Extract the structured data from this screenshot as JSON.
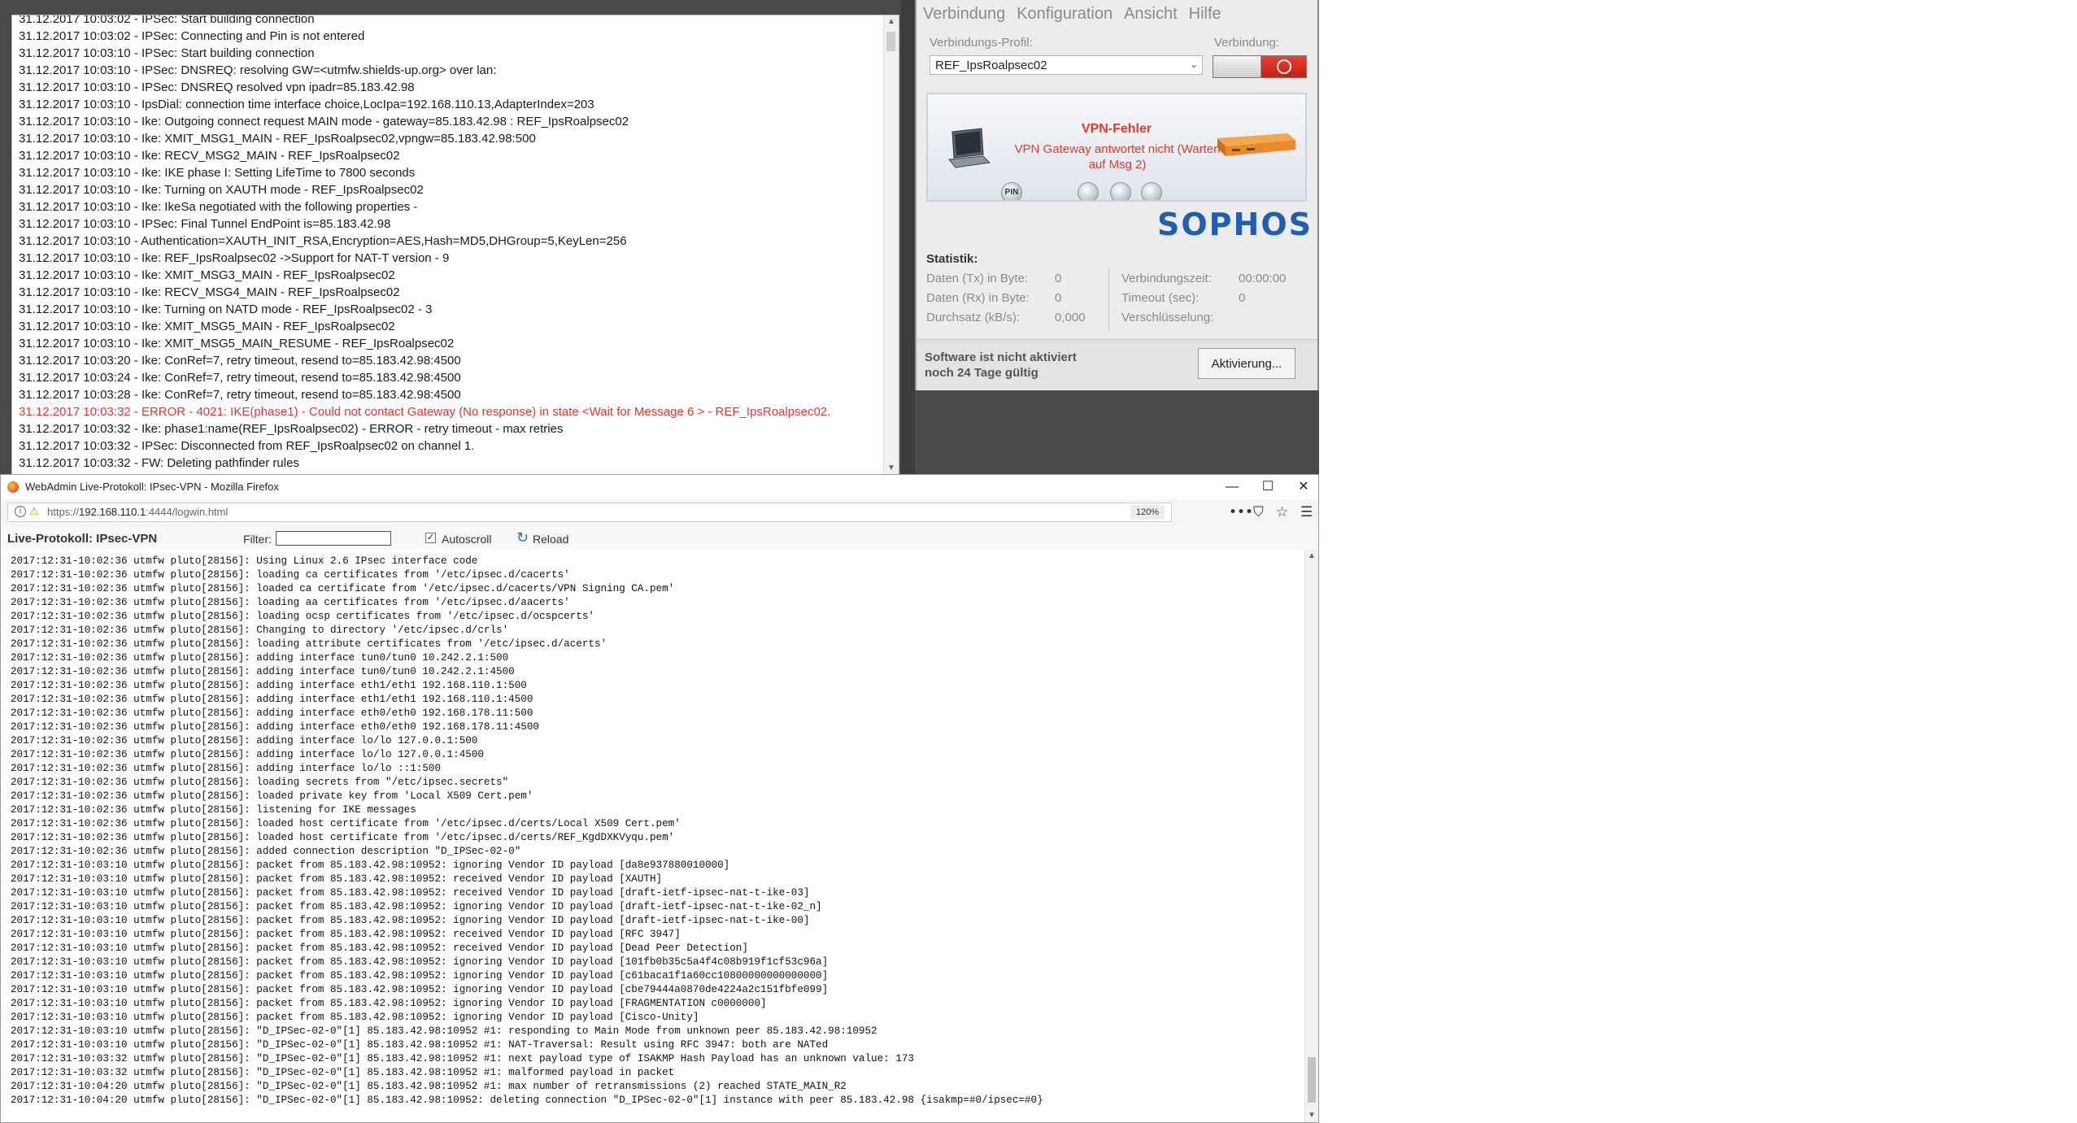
{
  "log_window": {
    "lines": [
      {
        "text": "31.12.2017 10:03:02 - IPSec: Start building connection",
        "error": false
      },
      {
        "text": "31.12.2017 10:03:02 - IPSec: Connecting and Pin is not entered",
        "error": false
      },
      {
        "text": "31.12.2017 10:03:10 - IPSec: Start building connection",
        "error": false
      },
      {
        "text": "31.12.2017 10:03:10 - IPSec: DNSREQ: resolving GW=<utmfw.shields-up.org> over lan:",
        "error": false
      },
      {
        "text": "31.12.2017 10:03:10 - IPSec: DNSREQ resolved vpn ipadr=85.183.42.98",
        "error": false
      },
      {
        "text": "31.12.2017 10:03:10 - IpsDial: connection time interface choice,LocIpa=192.168.110.13,AdapterIndex=203",
        "error": false
      },
      {
        "text": "31.12.2017 10:03:10 - Ike: Outgoing connect request MAIN mode - gateway=85.183.42.98 : REF_IpsRoalpsec02",
        "error": false
      },
      {
        "text": "31.12.2017 10:03:10 - Ike: XMIT_MSG1_MAIN - REF_IpsRoalpsec02,vpngw=85.183.42.98:500",
        "error": false
      },
      {
        "text": "31.12.2017 10:03:10 - Ike: RECV_MSG2_MAIN - REF_IpsRoalpsec02",
        "error": false
      },
      {
        "text": "31.12.2017 10:03:10 - Ike: IKE phase I: Setting LifeTime to 7800 seconds",
        "error": false
      },
      {
        "text": "31.12.2017 10:03:10 - Ike: Turning on XAUTH mode - REF_IpsRoalpsec02",
        "error": false
      },
      {
        "text": "31.12.2017 10:03:10 - Ike: IkeSa negotiated with the following properties -",
        "error": false
      },
      {
        "text": "31.12.2017 10:03:10 - IPSec: Final Tunnel EndPoint is=85.183.42.98",
        "error": false
      },
      {
        "text": "31.12.2017 10:03:10 -    Authentication=XAUTH_INIT_RSA,Encryption=AES,Hash=MD5,DHGroup=5,KeyLen=256",
        "error": false
      },
      {
        "text": "31.12.2017 10:03:10 - Ike: REF_IpsRoalpsec02 ->Support for NAT-T version - 9",
        "error": false
      },
      {
        "text": "31.12.2017 10:03:10 - Ike: XMIT_MSG3_MAIN - REF_IpsRoalpsec02",
        "error": false
      },
      {
        "text": "31.12.2017 10:03:10 - Ike: RECV_MSG4_MAIN - REF_IpsRoalpsec02",
        "error": false
      },
      {
        "text": "31.12.2017 10:03:10 - Ike: Turning on NATD mode - REF_IpsRoalpsec02 - 3",
        "error": false
      },
      {
        "text": "31.12.2017 10:03:10 - Ike: XMIT_MSG5_MAIN - REF_IpsRoalpsec02",
        "error": false
      },
      {
        "text": "31.12.2017 10:03:10 - Ike: XMIT_MSG5_MAIN_RESUME - REF_IpsRoalpsec02",
        "error": false
      },
      {
        "text": "31.12.2017 10:03:20 - Ike: ConRef=7, retry timeout, resend to=85.183.42.98:4500",
        "error": false
      },
      {
        "text": "31.12.2017 10:03:24 - Ike: ConRef=7, retry timeout, resend to=85.183.42.98:4500",
        "error": false
      },
      {
        "text": "31.12.2017 10:03:28 - Ike: ConRef=7, retry timeout, resend to=85.183.42.98:4500",
        "error": false
      },
      {
        "text": "31.12.2017 10:03:32 - ERROR - 4021: IKE(phase1) - Could not contact Gateway (No response) in state <Wait for Message 6 > - REF_IpsRoalpsec02.",
        "error": true
      },
      {
        "text": "31.12.2017 10:03:32 - Ike: phase1:name(REF_IpsRoalpsec02) - ERROR - retry timeout - max retries",
        "error": false
      },
      {
        "text": "31.12.2017 10:03:32 - IPSec: Disconnected from REF_IpsRoalpsec02 on channel 1.",
        "error": false
      },
      {
        "text": "31.12.2017 10:03:32 - FW: Deleting pathfinder rules",
        "error": false
      },
      {
        "text": "31.12.2017 10:03:32 - FW: Deleting pathfinder rules",
        "error": false
      }
    ]
  },
  "sophos": {
    "menu": [
      "Verbindung",
      "Konfiguration",
      "Ansicht",
      "Hilfe"
    ],
    "profile_label": "Verbindungs-Profil:",
    "profile_value": "REF_IpsRoalpsec02",
    "connection_label": "Verbindung:",
    "status_title": "VPN-Fehler",
    "status_message": "VPN Gateway antwortet nicht (Warten auf Msg 2)",
    "pin_label": "PIN",
    "logo_text": "SOPHOS",
    "stats_title": "Statistik:",
    "stats_left": [
      {
        "label": "Daten (Tx) in Byte:",
        "value": "0"
      },
      {
        "label": "Daten (Rx) in Byte:",
        "value": "0"
      },
      {
        "label": "Durchsatz (kB/s):",
        "value": "0,000"
      }
    ],
    "stats_right": [
      {
        "label": "Verbindungszeit:",
        "value": "00:00:00"
      },
      {
        "label": "Timeout (sec):",
        "value": "0"
      },
      {
        "label": "Verschlüsselung:",
        "value": ""
      }
    ],
    "activation_line1": "Software ist nicht aktiviert",
    "activation_line2": "noch 24 Tage gültig",
    "activation_button": "Aktivierung...",
    "colors": {
      "error": "#e23b2b",
      "brand": "#1f5eb3"
    }
  },
  "firefox": {
    "window_title": "WebAdmin Live-Protokoll: IPsec-VPN - Mozilla Firefox",
    "url_prefix": "https://",
    "url_host": "192.168.110.1",
    "url_rest": ":4444/logwin.html",
    "zoom": "120%",
    "page_heading": "Live-Protokoll: IPsec-VPN",
    "filter_label": "Filter:",
    "filter_value": "",
    "autoscroll_label": "Autoscroll",
    "autoscroll_checked": true,
    "reload_label": "Reload",
    "log_lines": [
      "2017:12:31-10:02:36 utmfw pluto[28156]: Using Linux 2.6 IPsec interface code",
      "2017:12:31-10:02:36 utmfw pluto[28156]: loading ca certificates from '/etc/ipsec.d/cacerts'",
      "2017:12:31-10:02:36 utmfw pluto[28156]: loaded ca certificate from '/etc/ipsec.d/cacerts/VPN Signing CA.pem'",
      "2017:12:31-10:02:36 utmfw pluto[28156]: loading aa certificates from '/etc/ipsec.d/aacerts'",
      "2017:12:31-10:02:36 utmfw pluto[28156]: loading ocsp certificates from '/etc/ipsec.d/ocspcerts'",
      "2017:12:31-10:02:36 utmfw pluto[28156]: Changing to directory '/etc/ipsec.d/crls'",
      "2017:12:31-10:02:36 utmfw pluto[28156]: loading attribute certificates from '/etc/ipsec.d/acerts'",
      "2017:12:31-10:02:36 utmfw pluto[28156]: adding interface tun0/tun0 10.242.2.1:500",
      "2017:12:31-10:02:36 utmfw pluto[28156]: adding interface tun0/tun0 10.242.2.1:4500",
      "2017:12:31-10:02:36 utmfw pluto[28156]: adding interface eth1/eth1 192.168.110.1:500",
      "2017:12:31-10:02:36 utmfw pluto[28156]: adding interface eth1/eth1 192.168.110.1:4500",
      "2017:12:31-10:02:36 utmfw pluto[28156]: adding interface eth0/eth0 192.168.178.11:500",
      "2017:12:31-10:02:36 utmfw pluto[28156]: adding interface eth0/eth0 192.168.178.11:4500",
      "2017:12:31-10:02:36 utmfw pluto[28156]: adding interface lo/lo 127.0.0.1:500",
      "2017:12:31-10:02:36 utmfw pluto[28156]: adding interface lo/lo 127.0.0.1:4500",
      "2017:12:31-10:02:36 utmfw pluto[28156]: adding interface lo/lo ::1:500",
      "2017:12:31-10:02:36 utmfw pluto[28156]: loading secrets from \"/etc/ipsec.secrets\"",
      "2017:12:31-10:02:36 utmfw pluto[28156]: loaded private key from 'Local X509 Cert.pem'",
      "2017:12:31-10:02:36 utmfw pluto[28156]: listening for IKE messages",
      "2017:12:31-10:02:36 utmfw pluto[28156]: loaded host certificate from '/etc/ipsec.d/certs/Local X509 Cert.pem'",
      "2017:12:31-10:02:36 utmfw pluto[28156]: loaded host certificate from '/etc/ipsec.d/certs/REF_KgdDXKVyqu.pem'",
      "2017:12:31-10:02:36 utmfw pluto[28156]: added connection description \"D_IPSec-02-0\"",
      "2017:12:31-10:03:10 utmfw pluto[28156]: packet from 85.183.42.98:10952: ignoring Vendor ID payload [da8e937880010000]",
      "2017:12:31-10:03:10 utmfw pluto[28156]: packet from 85.183.42.98:10952: received Vendor ID payload [XAUTH]",
      "2017:12:31-10:03:10 utmfw pluto[28156]: packet from 85.183.42.98:10952: received Vendor ID payload [draft-ietf-ipsec-nat-t-ike-03]",
      "2017:12:31-10:03:10 utmfw pluto[28156]: packet from 85.183.42.98:10952: ignoring Vendor ID payload [draft-ietf-ipsec-nat-t-ike-02_n]",
      "2017:12:31-10:03:10 utmfw pluto[28156]: packet from 85.183.42.98:10952: ignoring Vendor ID payload [draft-ietf-ipsec-nat-t-ike-00]",
      "2017:12:31-10:03:10 utmfw pluto[28156]: packet from 85.183.42.98:10952: received Vendor ID payload [RFC 3947]",
      "2017:12:31-10:03:10 utmfw pluto[28156]: packet from 85.183.42.98:10952: received Vendor ID payload [Dead Peer Detection]",
      "2017:12:31-10:03:10 utmfw pluto[28156]: packet from 85.183.42.98:10952: ignoring Vendor ID payload [101fb0b35c5a4f4c08b919f1cf53c96a]",
      "2017:12:31-10:03:10 utmfw pluto[28156]: packet from 85.183.42.98:10952: ignoring Vendor ID payload [c61baca1f1a60cc10800000000000000]",
      "2017:12:31-10:03:10 utmfw pluto[28156]: packet from 85.183.42.98:10952: ignoring Vendor ID payload [cbe79444a0870de4224a2c151fbfe099]",
      "2017:12:31-10:03:10 utmfw pluto[28156]: packet from 85.183.42.98:10952: ignoring Vendor ID payload [FRAGMENTATION c0000000]",
      "2017:12:31-10:03:10 utmfw pluto[28156]: packet from 85.183.42.98:10952: ignoring Vendor ID payload [Cisco-Unity]",
      "2017:12:31-10:03:10 utmfw pluto[28156]: \"D_IPSec-02-0\"[1] 85.183.42.98:10952 #1: responding to Main Mode from unknown peer 85.183.42.98:10952",
      "2017:12:31-10:03:10 utmfw pluto[28156]: \"D_IPSec-02-0\"[1] 85.183.42.98:10952 #1: NAT-Traversal: Result using RFC 3947: both are NATed",
      "2017:12:31-10:03:32 utmfw pluto[28156]: \"D_IPSec-02-0\"[1] 85.183.42.98:10952 #1: next payload type of ISAKMP Hash Payload has an unknown value: 173",
      "2017:12:31-10:03:32 utmfw pluto[28156]: \"D_IPSec-02-0\"[1] 85.183.42.98:10952 #1: malformed payload in packet",
      "2017:12:31-10:04:20 utmfw pluto[28156]: \"D_IPSec-02-0\"[1] 85.183.42.98:10952 #1: max number of retransmissions (2) reached STATE_MAIN_R2",
      "2017:12:31-10:04:20 utmfw pluto[28156]: \"D_IPSec-02-0\"[1] 85.183.42.98:10952: deleting connection \"D_IPSec-02-0\"[1] instance with peer 85.183.42.98 {isakmp=#0/ipsec=#0}"
    ]
  }
}
